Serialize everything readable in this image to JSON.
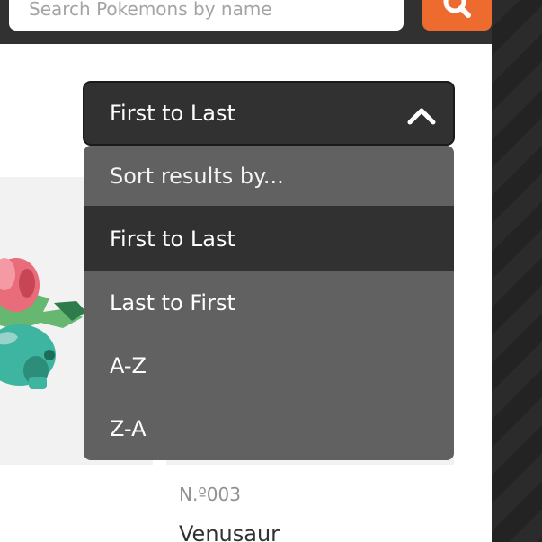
{
  "search": {
    "placeholder": "Search Pokemons by name"
  },
  "sort": {
    "current": "First to Last",
    "options": [
      {
        "label": "Sort results by..."
      },
      {
        "label": "First to Last"
      },
      {
        "label": "Last to First"
      },
      {
        "label": "A-Z"
      },
      {
        "label": "Z-A"
      }
    ],
    "selected_index": 1
  },
  "card": {
    "number": "N.º003",
    "name": "Venusaur"
  },
  "colors": {
    "accent": "#ee6b2f",
    "header_bg": "#313131",
    "menu_bg": "#616161",
    "card_bg": "#f2f2f2"
  },
  "icons": {
    "search_button": "search-icon",
    "select_toggle": "chevron-up-icon"
  }
}
